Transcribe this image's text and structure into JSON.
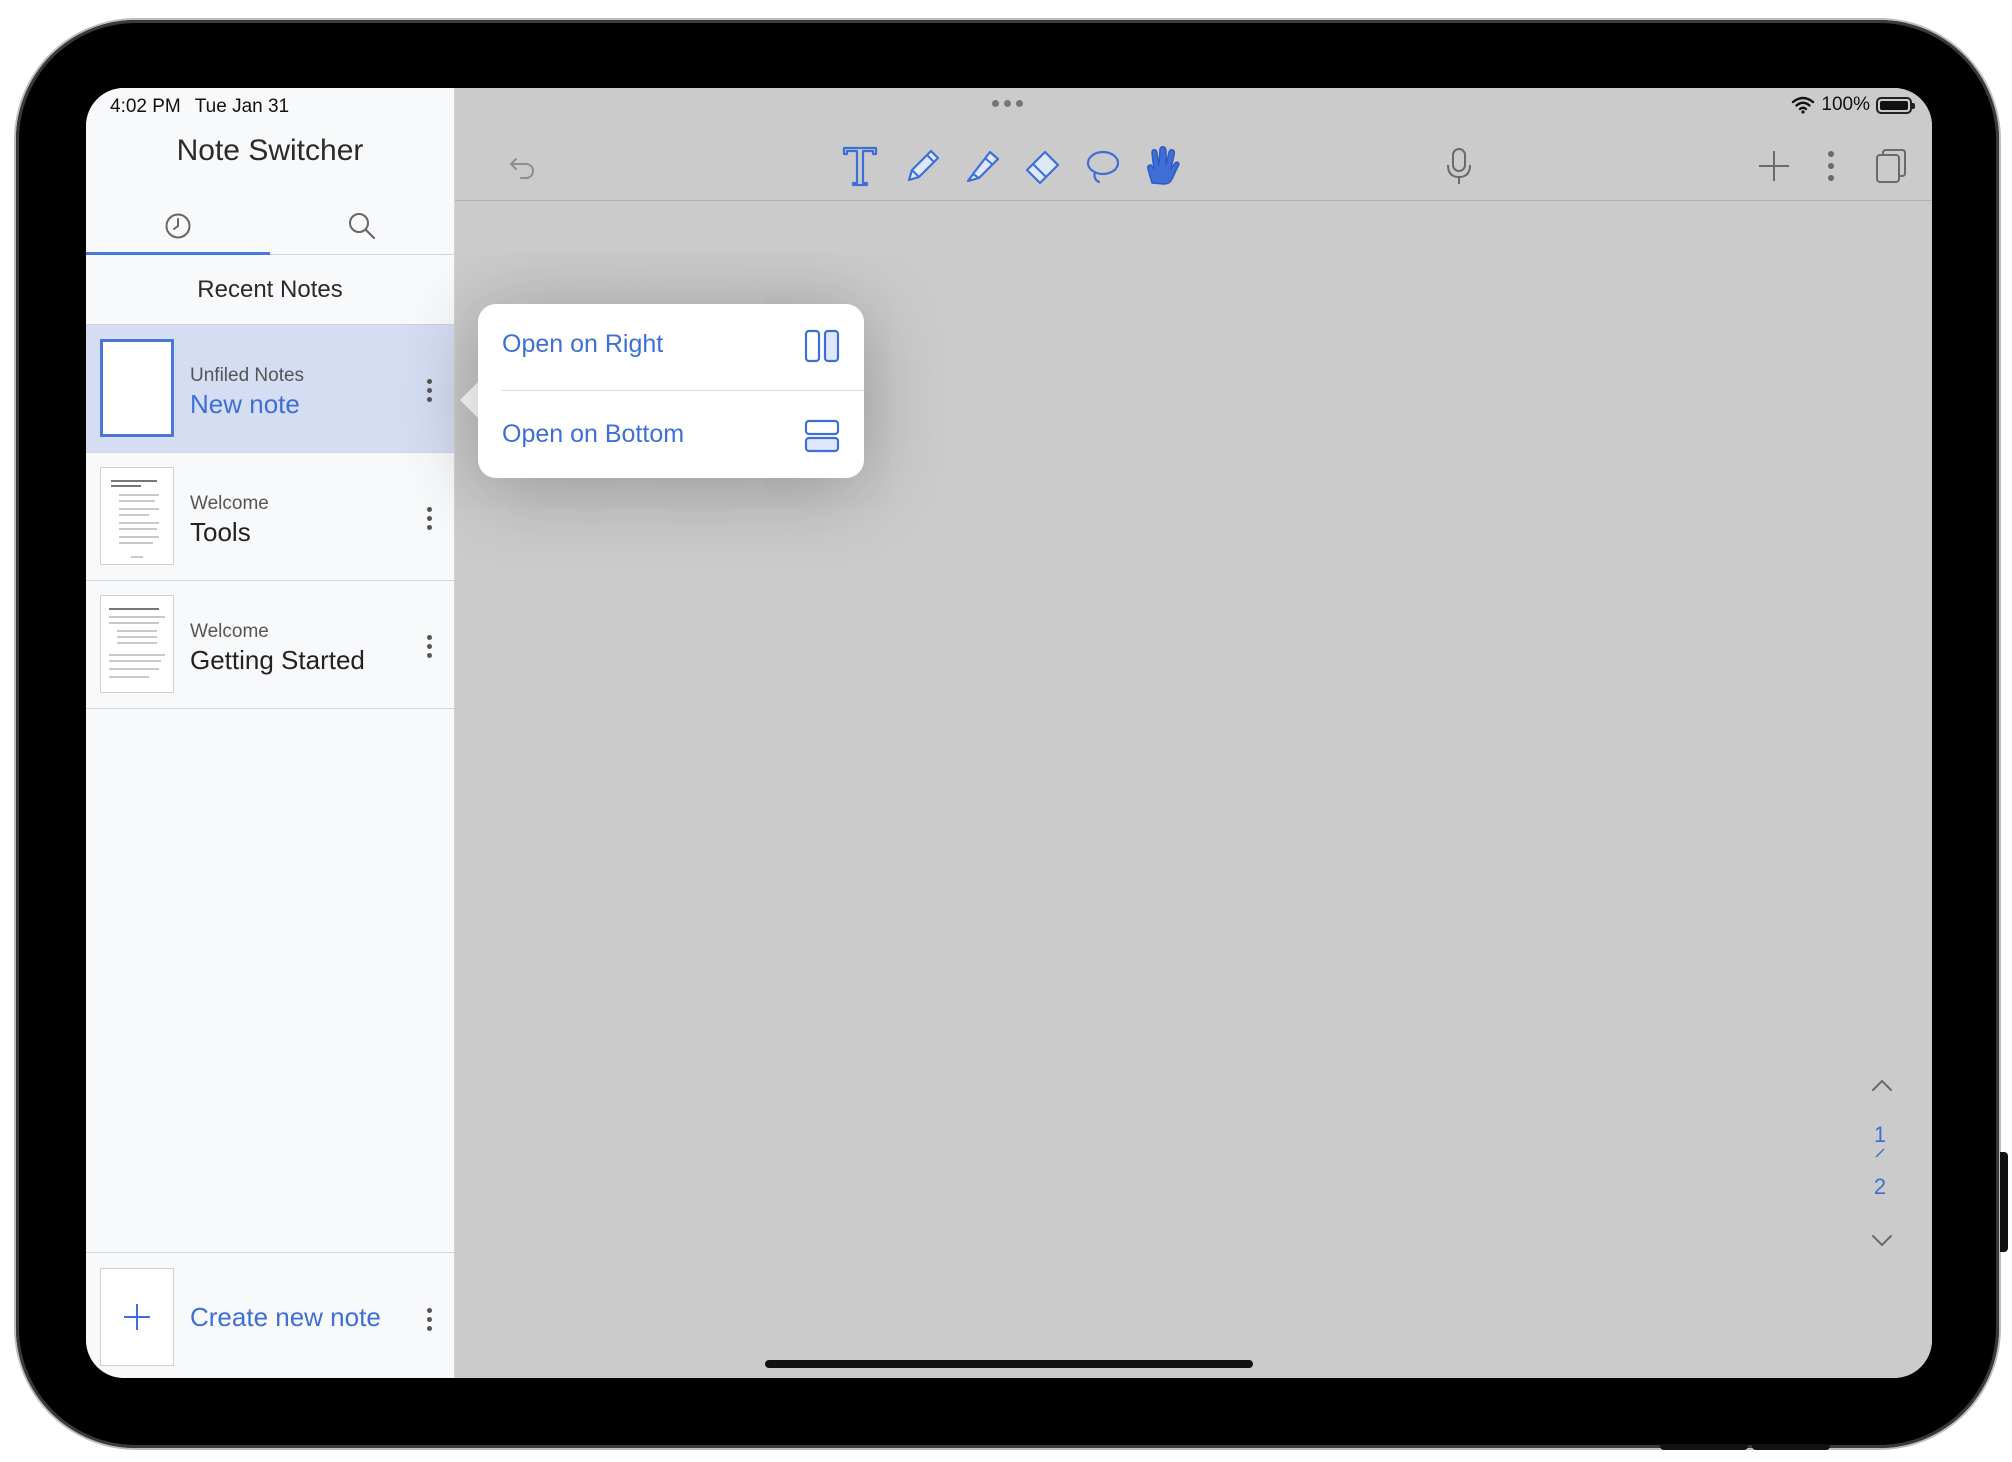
{
  "status": {
    "time": "4:02 PM",
    "date": "Tue Jan 31",
    "battery": "100%"
  },
  "sidebar": {
    "title": "Note Switcher",
    "tabs": [
      {
        "name": "recent",
        "icon": "clock-icon",
        "active": true
      },
      {
        "name": "search",
        "icon": "search-icon",
        "active": false
      }
    ],
    "section_title": "Recent Notes",
    "notes": [
      {
        "folder": "Unfiled Notes",
        "title": "New note",
        "selected": true
      },
      {
        "folder": "Welcome",
        "title": "Tools",
        "selected": false
      },
      {
        "folder": "Welcome",
        "title": "Getting Started",
        "selected": false
      }
    ],
    "create_label": "Create new note"
  },
  "toolbar": {
    "left": [
      "undo-icon"
    ],
    "tools": [
      "text-tool-icon",
      "pen-icon",
      "highlighter-icon",
      "eraser-icon",
      "lasso-icon",
      "hand-icon"
    ],
    "center": [
      "microphone-icon"
    ],
    "right": [
      "plus-icon",
      "more-icon",
      "pages-icon"
    ]
  },
  "popover": {
    "items": [
      {
        "label": "Open on Right",
        "icon": "split-vertical-icon"
      },
      {
        "label": "Open on Bottom",
        "icon": "split-horizontal-icon"
      }
    ]
  },
  "pager": {
    "current": "1",
    "total": "2"
  },
  "colors": {
    "accent": "#3d6fd6",
    "selected_row": "#d4ddf2",
    "canvas": "#cbcbcb"
  }
}
